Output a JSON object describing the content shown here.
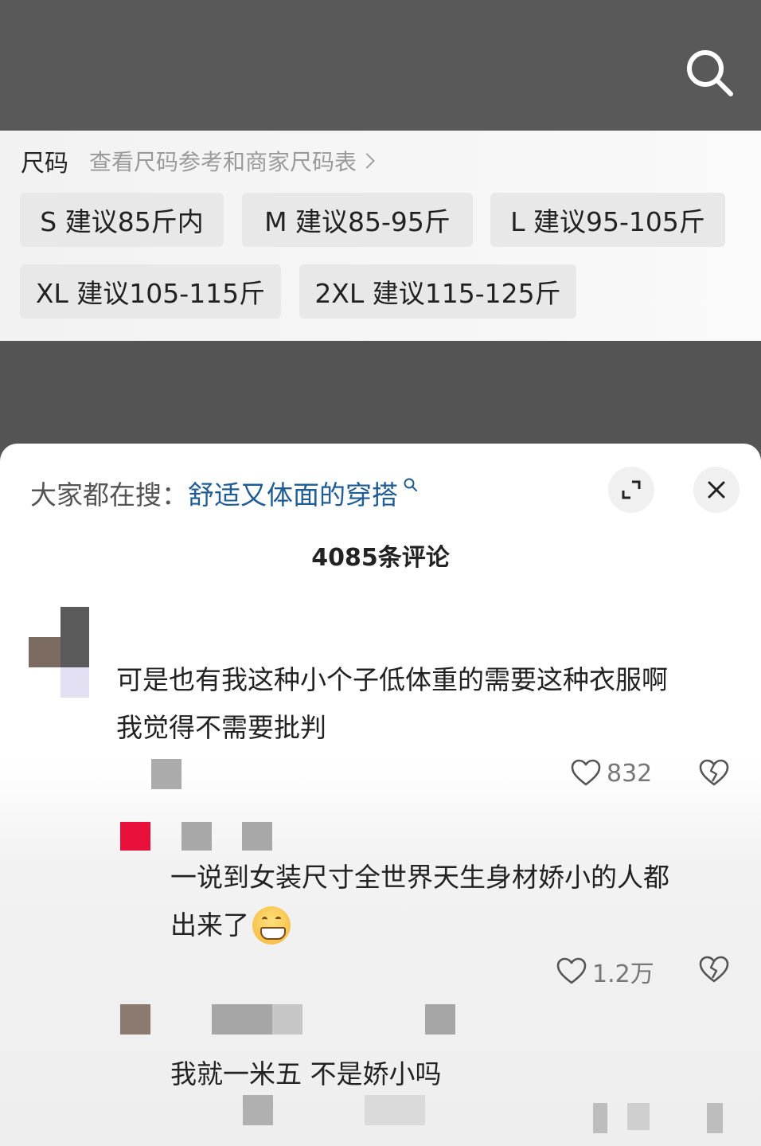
{
  "size_panel": {
    "title": "尺码",
    "link": "查看尺码参考和商家尺码表",
    "sizes": [
      "S 建议85斤内",
      "M 建议85-95斤",
      "L 建议95-105斤",
      "XL 建议105-115斤",
      "2XL 建议115-125斤"
    ]
  },
  "sheet": {
    "search_prefix": "大家都在搜：",
    "search_term": "舒适又体面的穿搭",
    "comment_count": "4085条评论"
  },
  "comments": [
    {
      "text_line1": "可是也有我这种小个子低体重的需要这种衣服啊",
      "text_line2": "我觉得不需要批判",
      "likes": "832"
    },
    {
      "text_line1": "一说到女装尺寸全世界天生身材娇小的人都",
      "text_line2": "出来了",
      "likes": "1.2万"
    },
    {
      "text_line1": "我就一米五 不是娇小吗"
    }
  ],
  "icons": {
    "search": "search-icon",
    "expand": "expand-icon",
    "close": "close-icon",
    "heart": "heart-icon",
    "broken_heart": "broken-heart-icon",
    "emoji": "grinning-emoji-icon"
  },
  "colors": {
    "link_blue": "#1f5c93",
    "dark_background": "#555555",
    "accent_red": "#e8103a"
  }
}
